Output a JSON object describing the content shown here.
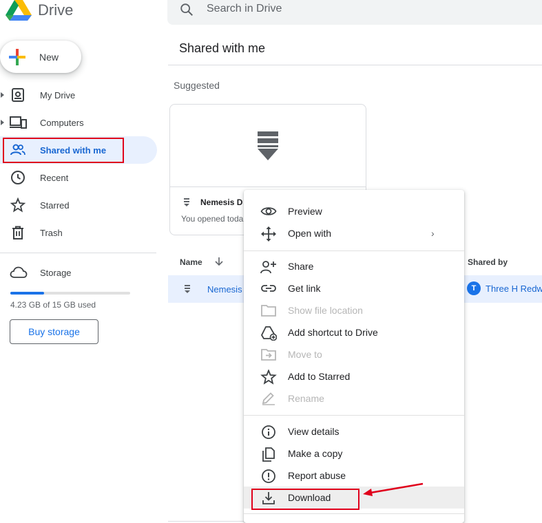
{
  "app": {
    "name": "Drive"
  },
  "search": {
    "placeholder": "Search in Drive"
  },
  "new_button": {
    "label": "New"
  },
  "sidebar": {
    "items": [
      {
        "label": "My Drive",
        "icon": "my-drive-icon"
      },
      {
        "label": "Computers",
        "icon": "computers-icon"
      },
      {
        "label": "Shared with me",
        "icon": "people-icon",
        "active": true
      },
      {
        "label": "Recent",
        "icon": "clock-icon"
      },
      {
        "label": "Starred",
        "icon": "star-icon"
      },
      {
        "label": "Trash",
        "icon": "trash-icon"
      }
    ],
    "storage": {
      "label": "Storage",
      "used_text": "4.23 GB of 15 GB used",
      "used_fraction": 0.282,
      "buy_label": "Buy storage"
    }
  },
  "main": {
    "title": "Shared with me",
    "suggested_label": "Suggested",
    "card": {
      "name": "Nemesis D",
      "subtitle": "You opened toda"
    },
    "columns": {
      "name": "Name",
      "shared_by": "Shared by"
    },
    "row": {
      "name": "Nemesis",
      "shared_by_initial": "T",
      "shared_by": "Three H Redw"
    }
  },
  "context_menu": {
    "items": [
      {
        "label": "Preview",
        "icon": "eye-icon"
      },
      {
        "label": "Open with",
        "icon": "move-icon",
        "submenu": "›"
      },
      {
        "label": "Share",
        "icon": "person-add-icon"
      },
      {
        "label": "Get link",
        "icon": "link-icon"
      },
      {
        "label": "Show file location",
        "icon": "folder-icon",
        "disabled": true
      },
      {
        "label": "Add shortcut to Drive",
        "icon": "add-to-drive-icon"
      },
      {
        "label": "Move to",
        "icon": "move-to-folder-icon",
        "disabled": true
      },
      {
        "label": "Add to Starred",
        "icon": "star-outline-icon"
      },
      {
        "label": "Rename",
        "icon": "pencil-icon",
        "disabled": true
      },
      {
        "label": "View details",
        "icon": "info-icon"
      },
      {
        "label": "Make a copy",
        "icon": "copy-icon"
      },
      {
        "label": "Report abuse",
        "icon": "report-icon"
      },
      {
        "label": "Download",
        "icon": "download-icon",
        "hovered": true
      }
    ]
  },
  "colors": {
    "accent": "#1a73e8",
    "active_bg": "#e8f0fe",
    "annotation_red": "#e0001b"
  }
}
